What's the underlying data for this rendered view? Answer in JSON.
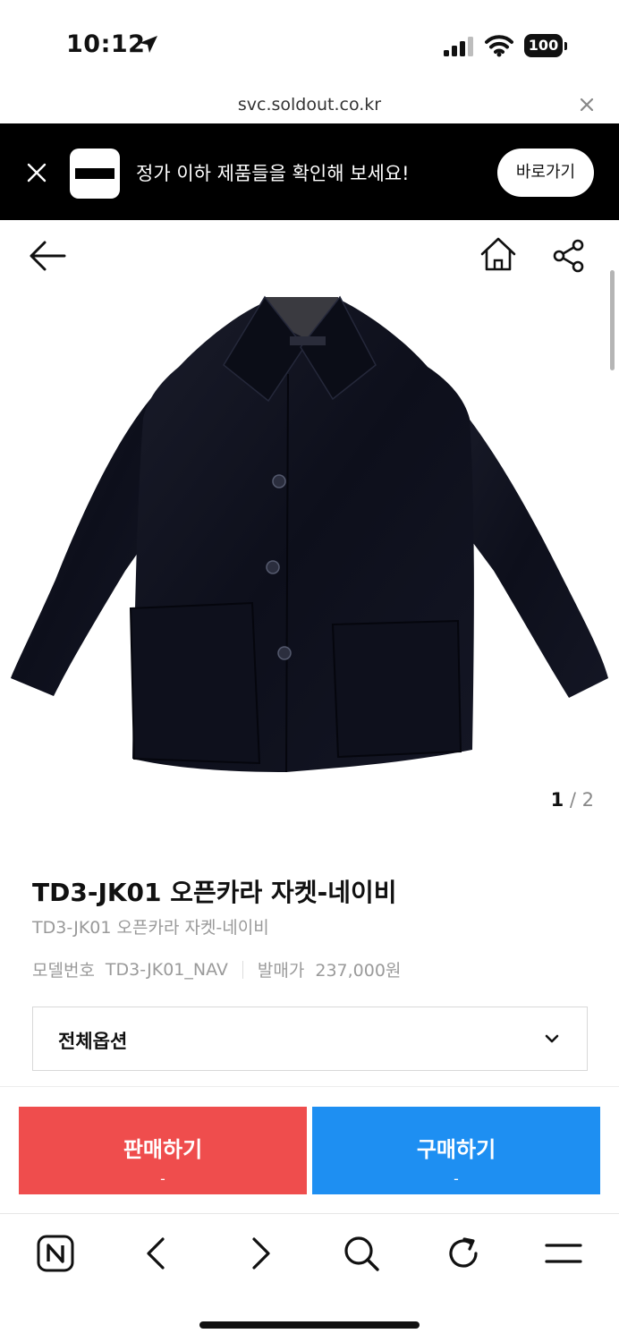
{
  "status_bar": {
    "time": "10:12",
    "battery": "100"
  },
  "browser": {
    "url": "svc.soldout.co.kr"
  },
  "promo_banner": {
    "message": "정가 이하 제품들을 확인해 보세요!",
    "button_label": "바로가기"
  },
  "gallery": {
    "current": "1",
    "separator": " / ",
    "total": "2"
  },
  "product": {
    "title": "TD3-JK01 오픈카라 자켓-네이비",
    "subtitle": "TD3-JK01 오픈카라 자켓-네이비",
    "model_label": "모델번호",
    "model_value": "TD3-JK01_NAV",
    "price_label": "발매가",
    "price_value": "237,000원"
  },
  "options": {
    "selected": "전체옵션"
  },
  "actions": {
    "sell_label": "판매하기",
    "sell_price": "-",
    "buy_label": "구매하기",
    "buy_price": "-"
  },
  "colors": {
    "sell": "#ef4d4d",
    "buy": "#1e8ff2",
    "banner": "#000000"
  },
  "icons": {
    "toolbar": [
      "naver-n-icon",
      "back-chevron-icon",
      "forward-chevron-icon",
      "search-icon",
      "refresh-icon",
      "menu-icon"
    ]
  }
}
